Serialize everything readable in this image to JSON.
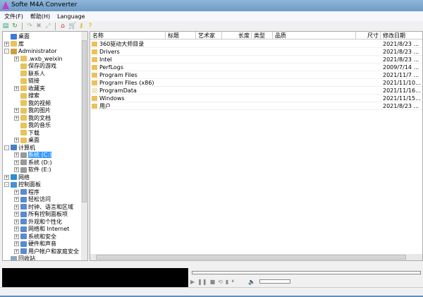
{
  "window": {
    "title": "Softe M4A Converter"
  },
  "menu": [
    "文件(F)",
    "帮助(H)",
    "Language"
  ],
  "toolbar": [
    "add-file",
    "refresh",
    "redo",
    "delete",
    "convert",
    "home",
    "cart",
    "key",
    "help"
  ],
  "tree": [
    {
      "label": "桌面",
      "level": 0,
      "exp": "",
      "icon": "desktop"
    },
    {
      "label": "库",
      "level": 0,
      "exp": "+",
      "icon": "library"
    },
    {
      "label": "Administrator",
      "level": 0,
      "exp": "-",
      "icon": "user"
    },
    {
      "label": ".wxb_weixin",
      "level": 1,
      "exp": "+",
      "icon": "folder"
    },
    {
      "label": "保存的游戏",
      "level": 1,
      "exp": "",
      "icon": "folder"
    },
    {
      "label": "联系人",
      "level": 1,
      "exp": "",
      "icon": "folder"
    },
    {
      "label": "链接",
      "level": 1,
      "exp": "",
      "icon": "folder"
    },
    {
      "label": "收藏夹",
      "level": 1,
      "exp": "+",
      "icon": "folder"
    },
    {
      "label": "搜索",
      "level": 1,
      "exp": "",
      "icon": "folder"
    },
    {
      "label": "我的视频",
      "level": 1,
      "exp": "",
      "icon": "folder"
    },
    {
      "label": "我的图片",
      "level": 1,
      "exp": "+",
      "icon": "folder"
    },
    {
      "label": "我的文档",
      "level": 1,
      "exp": "+",
      "icon": "folder"
    },
    {
      "label": "我的音乐",
      "level": 1,
      "exp": "",
      "icon": "folder"
    },
    {
      "label": "下载",
      "level": 1,
      "exp": "",
      "icon": "folder"
    },
    {
      "label": "桌面",
      "level": 1,
      "exp": "+",
      "icon": "folder"
    },
    {
      "label": "计算机",
      "level": 0,
      "exp": "-",
      "icon": "computer"
    },
    {
      "label": "系统 (C:)",
      "level": 1,
      "exp": "+",
      "icon": "drive",
      "selected": true
    },
    {
      "label": "系统 (D:)",
      "level": 1,
      "exp": "+",
      "icon": "drive"
    },
    {
      "label": "软件 (E:)",
      "level": 1,
      "exp": "+",
      "icon": "drive"
    },
    {
      "label": "网络",
      "level": 0,
      "exp": "+",
      "icon": "network"
    },
    {
      "label": "控制面板",
      "level": 0,
      "exp": "-",
      "icon": "control-panel"
    },
    {
      "label": "程序",
      "level": 1,
      "exp": "+",
      "icon": "cp"
    },
    {
      "label": "轻松访问",
      "level": 1,
      "exp": "+",
      "icon": "cp"
    },
    {
      "label": "时钟、语言和区域",
      "level": 1,
      "exp": "+",
      "icon": "cp"
    },
    {
      "label": "所有控制面板项",
      "level": 1,
      "exp": "+",
      "icon": "cp"
    },
    {
      "label": "外观和个性化",
      "level": 1,
      "exp": "+",
      "icon": "cp"
    },
    {
      "label": "网络和 Internet",
      "level": 1,
      "exp": "+",
      "icon": "cp"
    },
    {
      "label": "系统和安全",
      "level": 1,
      "exp": "+",
      "icon": "cp"
    },
    {
      "label": "硬件和声音",
      "level": 1,
      "exp": "+",
      "icon": "cp"
    },
    {
      "label": "用户帐户和家庭安全",
      "level": 1,
      "exp": "+",
      "icon": "cp"
    },
    {
      "label": "回收站",
      "level": 0,
      "exp": "",
      "icon": "recycle"
    }
  ],
  "columns": [
    "名称",
    "标题",
    "艺术家",
    "长度",
    "类型",
    "品质",
    "尺寸",
    "修改日期"
  ],
  "files": [
    {
      "name": "360驱动大师目录",
      "date": "2021/8/23 ..."
    },
    {
      "name": "Drivers",
      "date": "2021/8/23 ..."
    },
    {
      "name": "Intel",
      "date": "2021/8/23 ..."
    },
    {
      "name": "PerfLogs",
      "date": "2009/7/14 ..."
    },
    {
      "name": "Program Files",
      "date": "2021/11/7 ..."
    },
    {
      "name": "Program Files (x86)",
      "date": "2021/11/10..."
    },
    {
      "name": "ProgramData",
      "date": "2021/11/16...",
      "hidden": true
    },
    {
      "name": "Windows",
      "date": "2021/11/15..."
    },
    {
      "name": "用户",
      "date": "2021/8/23 ..."
    }
  ],
  "colors": {
    "selection": "#3399ff",
    "folder": "#e8c25a"
  }
}
